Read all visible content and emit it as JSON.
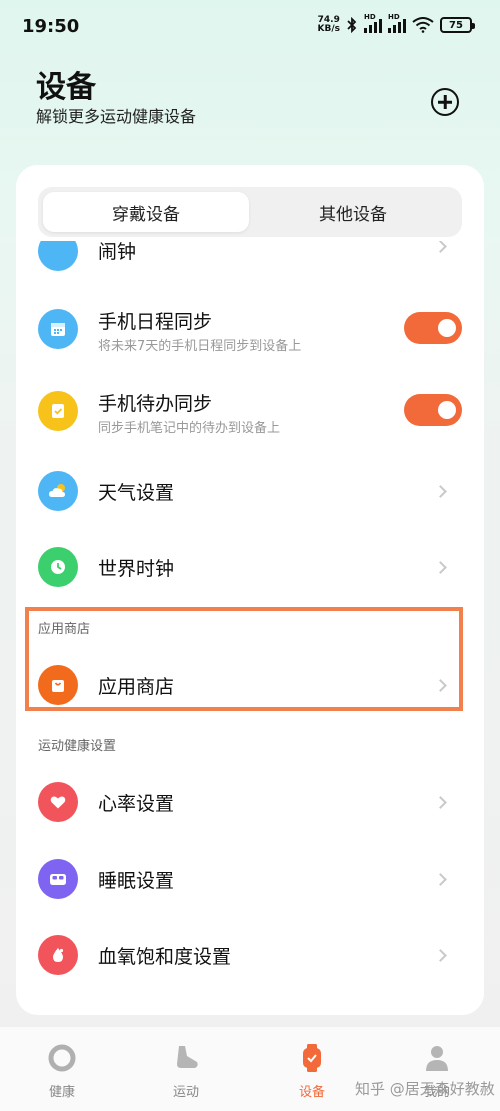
{
  "status_bar": {
    "time": "19:50",
    "net_speed_value": "74.9",
    "net_speed_unit": "KB/s",
    "hd1": "HD",
    "hd2": "HD",
    "battery": "75"
  },
  "header": {
    "title": "设备",
    "subtitle": "解锁更多运动健康设备",
    "add_icon": "plus-circle-icon"
  },
  "segment": {
    "tabs": [
      "穿戴设备",
      "其他设备"
    ],
    "selected": "穿戴设备"
  },
  "list": {
    "partial_item_label": "闹钟",
    "items": [
      {
        "label": "手机日程同步",
        "desc": "将未来7天的手机日程同步到设备上",
        "icon": "calendar-icon",
        "color": "#4fb6f5",
        "control": "toggle-on"
      },
      {
        "label": "手机待办同步",
        "desc": "同步手机笔记中的待办到设备上",
        "icon": "todo-icon",
        "color": "#f7c21a",
        "control": "toggle-on"
      },
      {
        "label": "天气设置",
        "icon": "weather-icon",
        "color": "#4fb6f5",
        "control": "chevron"
      },
      {
        "label": "世界时钟",
        "icon": "clock-icon",
        "color": "#3ccf6e",
        "control": "chevron"
      }
    ],
    "app_store_section": {
      "header": "应用商店",
      "item": {
        "label": "应用商店",
        "icon": "shopping-bag-icon",
        "color": "#f26a1b",
        "control": "chevron"
      }
    },
    "health_section": {
      "header": "运动健康设置",
      "items": [
        {
          "label": "心率设置",
          "icon": "heart-icon",
          "color": "#f2545b",
          "control": "chevron"
        },
        {
          "label": "睡眠设置",
          "icon": "bed-icon",
          "color": "#7e64f0",
          "control": "chevron"
        },
        {
          "label": "血氧饱和度设置",
          "icon": "droplet-icon",
          "color": "#f2545b",
          "control": "chevron"
        }
      ]
    }
  },
  "bottom_nav": {
    "items": [
      {
        "label": "健康",
        "icon": "health-ring-icon"
      },
      {
        "label": "运动",
        "icon": "shoe-icon"
      },
      {
        "label": "设备",
        "icon": "watch-icon"
      },
      {
        "label": "我的",
        "icon": "person-icon"
      }
    ],
    "selected": "设备"
  },
  "watermark": "知乎 @居无森好教赦",
  "colors": {
    "accent": "#f26a3a",
    "highlight": "#f2804c"
  }
}
